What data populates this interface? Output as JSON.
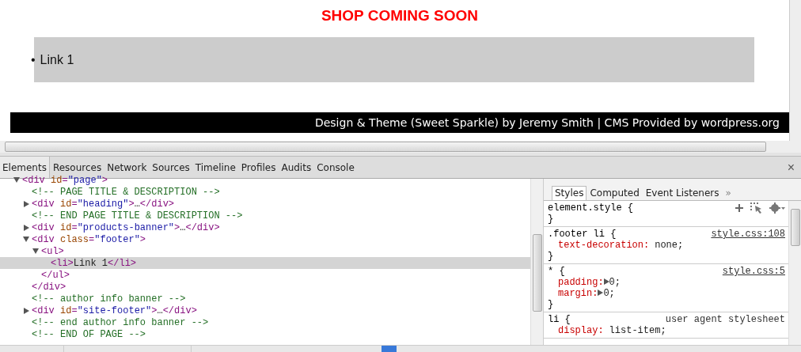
{
  "page": {
    "heading": "SHOP COMING SOON",
    "links": [
      {
        "marker": "•",
        "text": "Link 1"
      }
    ],
    "footer": "Design & Theme (Sweet Sparkle) by Jeremy Smith | CMS Provided by wordpress.org"
  },
  "devtools": {
    "tabs": [
      {
        "label": "Elements",
        "selected": true
      },
      {
        "label": "Resources",
        "selected": false
      },
      {
        "label": "Network",
        "selected": false
      },
      {
        "label": "Sources",
        "selected": false
      },
      {
        "label": "Timeline",
        "selected": false
      },
      {
        "label": "Profiles",
        "selected": false
      },
      {
        "label": "Audits",
        "selected": false
      },
      {
        "label": "Console",
        "selected": false
      }
    ],
    "close": "×",
    "dom_tree": [
      {
        "kind": "tag",
        "text": "<div id=\"page\">",
        "expanded": true,
        "selected": false,
        "children": [
          {
            "kind": "comment",
            "text": "<!-- PAGE TITLE & DESCRIPTION -->",
            "selected": false
          },
          {
            "kind": "tag",
            "text": "<div id=\"heading\">…</div>",
            "expanded": false,
            "selected": false
          },
          {
            "kind": "comment",
            "text": "<!-- END PAGE TITLE & DESCRIPTION -->",
            "selected": false
          },
          {
            "kind": "tag",
            "text": "<div id=\"products-banner\">…</div>",
            "expanded": false,
            "selected": false
          },
          {
            "kind": "tag",
            "text": "<div class=\"footer\">",
            "expanded": true,
            "selected": false,
            "closing": "</div>",
            "children": [
              {
                "kind": "tag",
                "text": "<ul>",
                "expanded": true,
                "selected": false,
                "closing": "</ul>",
                "children": [
                  {
                    "kind": "leaf",
                    "text": "<li>Link 1</li>",
                    "selected": true
                  }
                ]
              }
            ]
          },
          {
            "kind": "comment",
            "text": "<!-- author info banner -->",
            "selected": false
          },
          {
            "kind": "tag",
            "text": "<div id=\"site-footer\">…</div>",
            "expanded": false,
            "selected": false
          },
          {
            "kind": "comment",
            "text": "<!-- end author info banner -->",
            "selected": false
          },
          {
            "kind": "comment",
            "text": "<!-- END OF PAGE -->",
            "selected": false
          }
        ]
      }
    ],
    "side_tabs": [
      {
        "label": "Styles",
        "selected": true
      },
      {
        "label": "Computed",
        "selected": false
      },
      {
        "label": "Event Listeners",
        "selected": false
      }
    ],
    "side_more": "»",
    "rules": [
      {
        "selector": "element.style {",
        "closing": "}"
      },
      {
        "selector": ".footer li {",
        "source": "style.css:108",
        "underlined": true,
        "properties": [
          {
            "name": "text-decoration:",
            "value": "none;",
            "expandable": false
          }
        ],
        "closing": "}"
      },
      {
        "selector": "* {",
        "source": "style.css:5",
        "underlined": true,
        "properties": [
          {
            "name": "padding:",
            "value": "0;",
            "expandable": true
          },
          {
            "name": "margin:",
            "value": "0;",
            "expandable": true
          }
        ],
        "closing": "}"
      },
      {
        "selector": "li {",
        "source": "user agent stylesheet",
        "underlined": false,
        "properties": [
          {
            "name": "display:",
            "value": "list-item;",
            "expandable": false
          }
        ]
      }
    ]
  }
}
